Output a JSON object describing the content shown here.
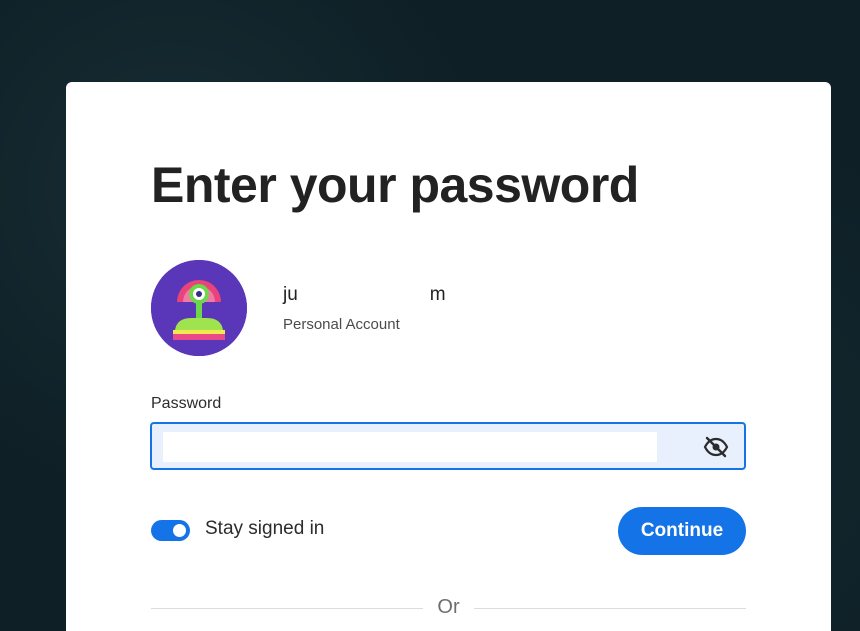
{
  "page": {
    "title": "Enter your password"
  },
  "account": {
    "email_display": "ju                         m",
    "type": "Personal Account"
  },
  "password": {
    "label": "Password",
    "value": "",
    "placeholder": ""
  },
  "stay_signed_in": {
    "label": "Stay signed in",
    "enabled": true
  },
  "actions": {
    "continue_label": "Continue"
  },
  "separator": {
    "or_label": "Or"
  },
  "icons": {
    "visibility": "eye-off-icon",
    "avatar": "avatar-illustration"
  },
  "colors": {
    "accent": "#1473e6",
    "background": "#0e1f25",
    "avatar_bg": "#5a36b8"
  }
}
